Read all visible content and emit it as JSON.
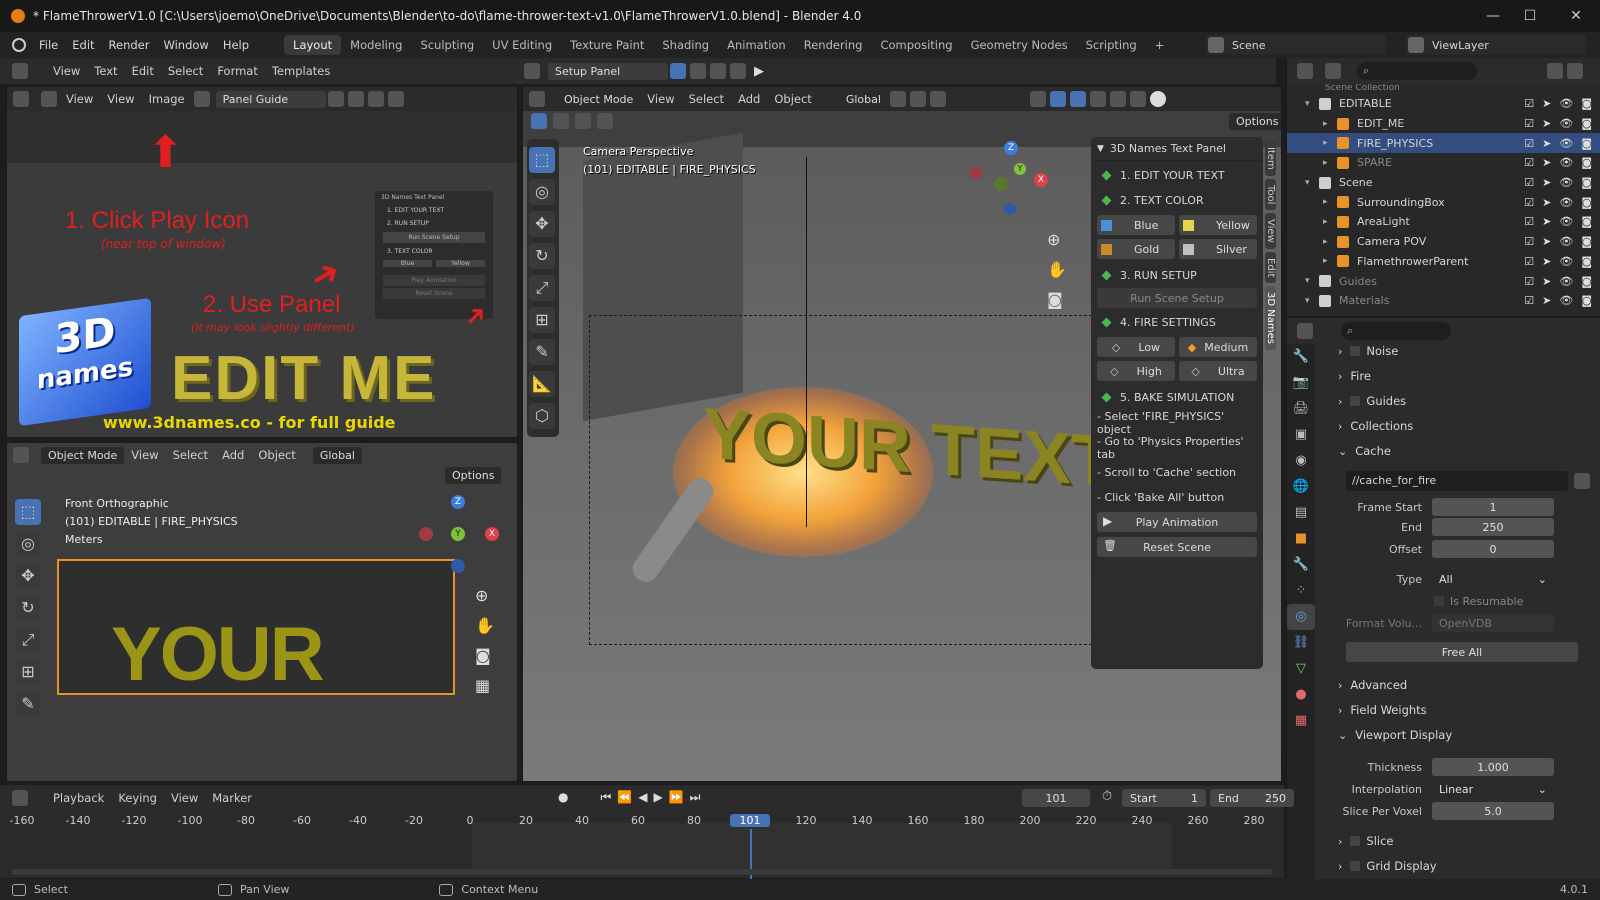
{
  "window": {
    "title": "* FlameThrowerV1.0 [C:\\Users\\joemo\\OneDrive\\Documents\\Blender\\to-do\\flame-thrower-text-v1.0\\FlameThrowerV1.0.blend] - Blender 4.0",
    "minimize": "—",
    "maximize": "☐",
    "close": "✕"
  },
  "menu": [
    "File",
    "Edit",
    "Render",
    "Window",
    "Help"
  ],
  "workspaces": [
    "Layout",
    "Modeling",
    "Sculpting",
    "UV Editing",
    "Texture Paint",
    "Shading",
    "Animation",
    "Rendering",
    "Compositing",
    "Geometry Nodes",
    "Scripting",
    "+"
  ],
  "scene": {
    "name": "Scene",
    "view_layer": "ViewLayer"
  },
  "text_editor": {
    "menus": [
      "View",
      "Text",
      "Edit",
      "Select",
      "Format",
      "Templates"
    ],
    "file": "Setup Panel"
  },
  "image_editor": {
    "menus": [
      "View",
      "View",
      "Image"
    ],
    "image": "Panel Guide"
  },
  "guide": {
    "step1": "1. Click Play Icon",
    "step1_sub": "(near top of window)",
    "step2": "2. Use Panel",
    "step2_sub": "(it may look slightly different)",
    "logo_top": "3D",
    "logo_bottom": "names",
    "edit_me": "EDIT ME",
    "url": "www.3dnames.co - for full guide",
    "mini_panel_title": "3D Names Text Panel",
    "mini_items": [
      "1. EDIT YOUR TEXT",
      "2. RUN SETUP",
      "Run Scene Setup",
      "3. TEXT COLOR",
      "Blue",
      "Yellow",
      "Play Animation",
      "Reset Scene"
    ]
  },
  "front_view": {
    "menus": [
      "Object Mode",
      "View",
      "Select",
      "Add",
      "Object",
      "Global"
    ],
    "options": "Options",
    "info1": "Front Orthographic",
    "info2": "(101) EDITABLE | FIRE_PHYSICS",
    "info3": "Meters",
    "text": "YOUR TEXT",
    "axes": {
      "z": "Z",
      "y": "Y",
      "x": "X"
    }
  },
  "main_view": {
    "menus": [
      "Object Mode",
      "View",
      "Select",
      "Add",
      "Object",
      "Global"
    ],
    "options": "Options",
    "info1": "Camera Perspective",
    "info2": "(101) EDITABLE | FIRE_PHYSICS",
    "text": "YOUR TEXT",
    "axes": {
      "z": "Z",
      "y": "Y",
      "x": "X"
    },
    "side_tabs": [
      "Item",
      "Tool",
      "View",
      "Edit",
      "3D Names"
    ]
  },
  "names_panel": {
    "title": "3D Names Text Panel",
    "edit_text": "1. EDIT YOUR TEXT",
    "text_color": "2. TEXT COLOR",
    "colors": [
      {
        "label": "Blue",
        "color": "#4a90d9"
      },
      {
        "label": "Yellow",
        "color": "#e8d44a"
      },
      {
        "label": "Gold",
        "color": "#c98a2a"
      },
      {
        "label": "Silver",
        "color": "#c0c0c0"
      }
    ],
    "run_setup": "3. RUN SETUP",
    "run_scene_setup": "Run Scene Setup",
    "fire_settings": "4. FIRE SETTINGS",
    "fire_levels": [
      "Low",
      "Medium",
      "High",
      "Ultra"
    ],
    "bake": "5. BAKE SIMULATION",
    "bake_steps": [
      "- Select 'FIRE_PHYSICS' object",
      "- Go to 'Physics Properties' tab",
      "- Scroll to 'Cache' section",
      "- Click 'Bake All' button"
    ],
    "play_animation": "Play Animation",
    "reset_scene": "Reset Scene"
  },
  "outliner": {
    "partial_top": "Scene Collection",
    "rows": [
      {
        "label": "EDITABLE",
        "indent": 1,
        "type": "collection",
        "selected": false
      },
      {
        "label": "EDIT_ME",
        "indent": 2,
        "type": "object",
        "selected": false
      },
      {
        "label": "FIRE_PHYSICS",
        "indent": 2,
        "type": "object",
        "selected": true
      },
      {
        "label": "SPARE",
        "indent": 2,
        "type": "object",
        "selected": false
      },
      {
        "label": "Scene",
        "indent": 1,
        "type": "collection",
        "selected": false
      },
      {
        "label": "SurroundingBox",
        "indent": 2,
        "type": "object",
        "selected": false
      },
      {
        "label": "AreaLight",
        "indent": 2,
        "type": "light",
        "selected": false
      },
      {
        "label": "Camera POV",
        "indent": 2,
        "type": "camera",
        "selected": false
      },
      {
        "label": "FlamethrowerParent",
        "indent": 2,
        "type": "object",
        "selected": false
      },
      {
        "label": "Guides",
        "indent": 1,
        "type": "collection",
        "selected": false
      },
      {
        "label": "Materials",
        "indent": 1,
        "type": "collection",
        "selected": false
      }
    ]
  },
  "properties": {
    "noise": "Noise",
    "fire": "Fire",
    "guides": "Guides",
    "collections": "Collections",
    "cache": "Cache",
    "cache_path": "//cache_for_fire",
    "frame_start_label": "Frame Start",
    "frame_start": "1",
    "end_label": "End",
    "end": "250",
    "offset_label": "Offset",
    "offset": "0",
    "type_label": "Type",
    "type": "All",
    "is_resumable": "Is Resumable",
    "format_label": "Format Volu...",
    "format": "OpenVDB",
    "free_all": "Free All",
    "advanced": "Advanced",
    "field_weights": "Field Weights",
    "viewport_display": "Viewport Display",
    "thickness_label": "Thickness",
    "thickness": "1.000",
    "interpolation_label": "Interpolation",
    "interpolation": "Linear",
    "slice_per_voxel_label": "Slice Per Voxel",
    "slice_per_voxel": "5.0",
    "slice": "Slice",
    "grid_display": "Grid Display"
  },
  "timeline": {
    "menus": [
      "Playback",
      "Keying",
      "View",
      "Marker"
    ],
    "current_frame": "101",
    "start_label": "Start",
    "start": "1",
    "end_label": "End",
    "end": "250",
    "ticks": [
      "-160",
      "-140",
      "-120",
      "-100",
      "-80",
      "-60",
      "-40",
      "-20",
      "0",
      "20",
      "40",
      "60",
      "80",
      "101",
      "120",
      "140",
      "160",
      "180",
      "200",
      "220",
      "240",
      "260",
      "280"
    ]
  },
  "status_bar": {
    "select": "Select",
    "pan": "Pan View",
    "context": "Context Menu",
    "version": "4.0.1"
  }
}
